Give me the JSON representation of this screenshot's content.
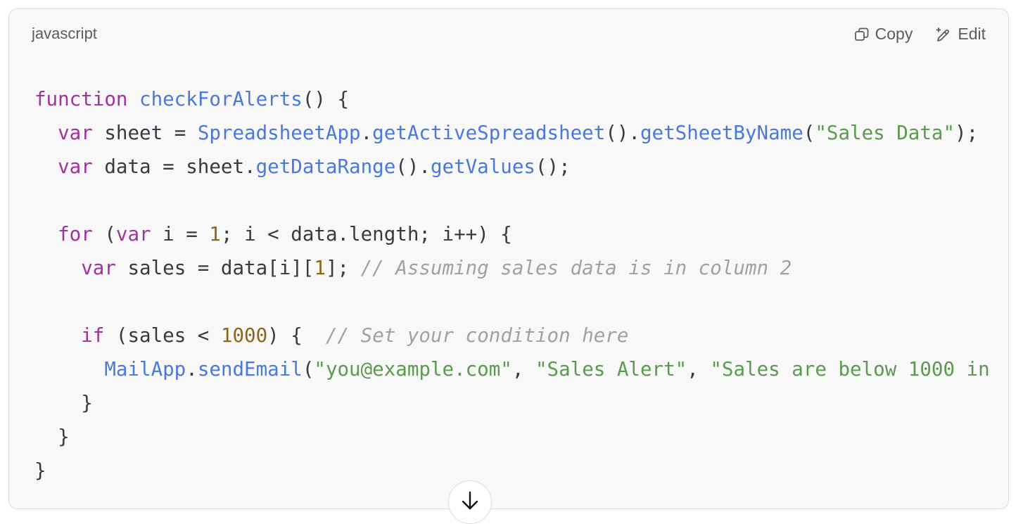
{
  "code_block": {
    "language": "javascript",
    "actions": {
      "copy_label": "Copy",
      "copy_icon": "copy-icon",
      "edit_label": "Edit",
      "edit_icon": "edit-pencil-sparkle-icon"
    },
    "colors": {
      "background": "#f8f8f8",
      "keyword": "#a0329d",
      "function": "#4b78dc",
      "string": "#5a9a4f",
      "number": "#8e6519",
      "comment": "#a0a1a7",
      "plain": "#383a42"
    },
    "lines": [
      [
        [
          "kw",
          "function"
        ],
        [
          "pl",
          " "
        ],
        [
          "fn",
          "checkForAlerts"
        ],
        [
          "pl",
          "() {"
        ]
      ],
      [
        [
          "pl",
          "  "
        ],
        [
          "kw",
          "var"
        ],
        [
          "pl",
          " sheet = "
        ],
        [
          "fn",
          "SpreadsheetApp"
        ],
        [
          "pl",
          "."
        ],
        [
          "fn",
          "getActiveSpreadsheet"
        ],
        [
          "pl",
          "()."
        ],
        [
          "fn",
          "getSheetByName"
        ],
        [
          "pl",
          "("
        ],
        [
          "str",
          "\"Sales Data\""
        ],
        [
          "pl",
          ");"
        ]
      ],
      [
        [
          "pl",
          "  "
        ],
        [
          "kw",
          "var"
        ],
        [
          "pl",
          " data = sheet."
        ],
        [
          "fn",
          "getDataRange"
        ],
        [
          "pl",
          "()."
        ],
        [
          "fn",
          "getValues"
        ],
        [
          "pl",
          "();"
        ]
      ],
      [
        [
          "pl",
          ""
        ]
      ],
      [
        [
          "pl",
          "  "
        ],
        [
          "kw",
          "for"
        ],
        [
          "pl",
          " ("
        ],
        [
          "kw",
          "var"
        ],
        [
          "pl",
          " i = "
        ],
        [
          "num",
          "1"
        ],
        [
          "pl",
          "; i < data.length; i++) {"
        ]
      ],
      [
        [
          "pl",
          "    "
        ],
        [
          "kw",
          "var"
        ],
        [
          "pl",
          " sales = data[i]["
        ],
        [
          "num",
          "1"
        ],
        [
          "pl",
          "]; "
        ],
        [
          "cmt",
          "// Assuming sales data is in column 2"
        ]
      ],
      [
        [
          "pl",
          ""
        ]
      ],
      [
        [
          "pl",
          "    "
        ],
        [
          "kw",
          "if"
        ],
        [
          "pl",
          " (sales < "
        ],
        [
          "num",
          "1000"
        ],
        [
          "pl",
          ") {  "
        ],
        [
          "cmt",
          "// Set your condition here"
        ]
      ],
      [
        [
          "pl",
          "      "
        ],
        [
          "fn",
          "MailApp"
        ],
        [
          "pl",
          "."
        ],
        [
          "fn",
          "sendEmail"
        ],
        [
          "pl",
          "("
        ],
        [
          "str",
          "\"you@example.com\""
        ],
        [
          "pl",
          ", "
        ],
        [
          "str",
          "\"Sales Alert\""
        ],
        [
          "pl",
          ", "
        ],
        [
          "str",
          "\"Sales are below 1000 in"
        ]
      ],
      [
        [
          "pl",
          "    }"
        ]
      ],
      [
        [
          "pl",
          "  }"
        ]
      ],
      [
        [
          "pl",
          "}"
        ]
      ]
    ],
    "scroll_button_icon": "arrow-down-icon"
  }
}
